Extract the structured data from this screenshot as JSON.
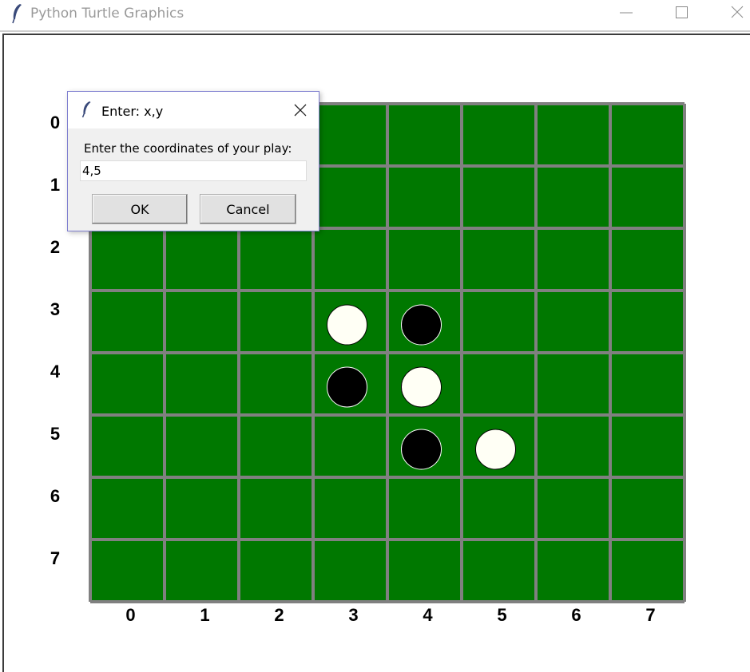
{
  "window": {
    "title": "Python Turtle Graphics",
    "icon": "feather-icon",
    "controls": [
      "minimize-icon",
      "maximize-icon",
      "close-icon"
    ]
  },
  "board": {
    "rows": 8,
    "cols": 8,
    "row_labels": [
      "0",
      "1",
      "2",
      "3",
      "4",
      "5",
      "6",
      "7"
    ],
    "col_labels": [
      "0",
      "1",
      "2",
      "3",
      "4",
      "5",
      "6",
      "7"
    ],
    "colors": {
      "felt": "#007800",
      "grid": "#808080",
      "black": "#000000",
      "white": "#fffff5"
    },
    "pieces": [
      {
        "row": 3,
        "col": 3,
        "color": "white"
      },
      {
        "row": 3,
        "col": 4,
        "color": "black"
      },
      {
        "row": 4,
        "col": 3,
        "color": "black"
      },
      {
        "row": 4,
        "col": 4,
        "color": "white"
      },
      {
        "row": 5,
        "col": 4,
        "color": "black"
      },
      {
        "row": 5,
        "col": 5,
        "color": "white"
      }
    ]
  },
  "dialog": {
    "title": "Enter: x,y",
    "prompt": "Enter the coordinates of your play:",
    "input_value": "4,5",
    "ok_label": "OK",
    "cancel_label": "Cancel"
  }
}
